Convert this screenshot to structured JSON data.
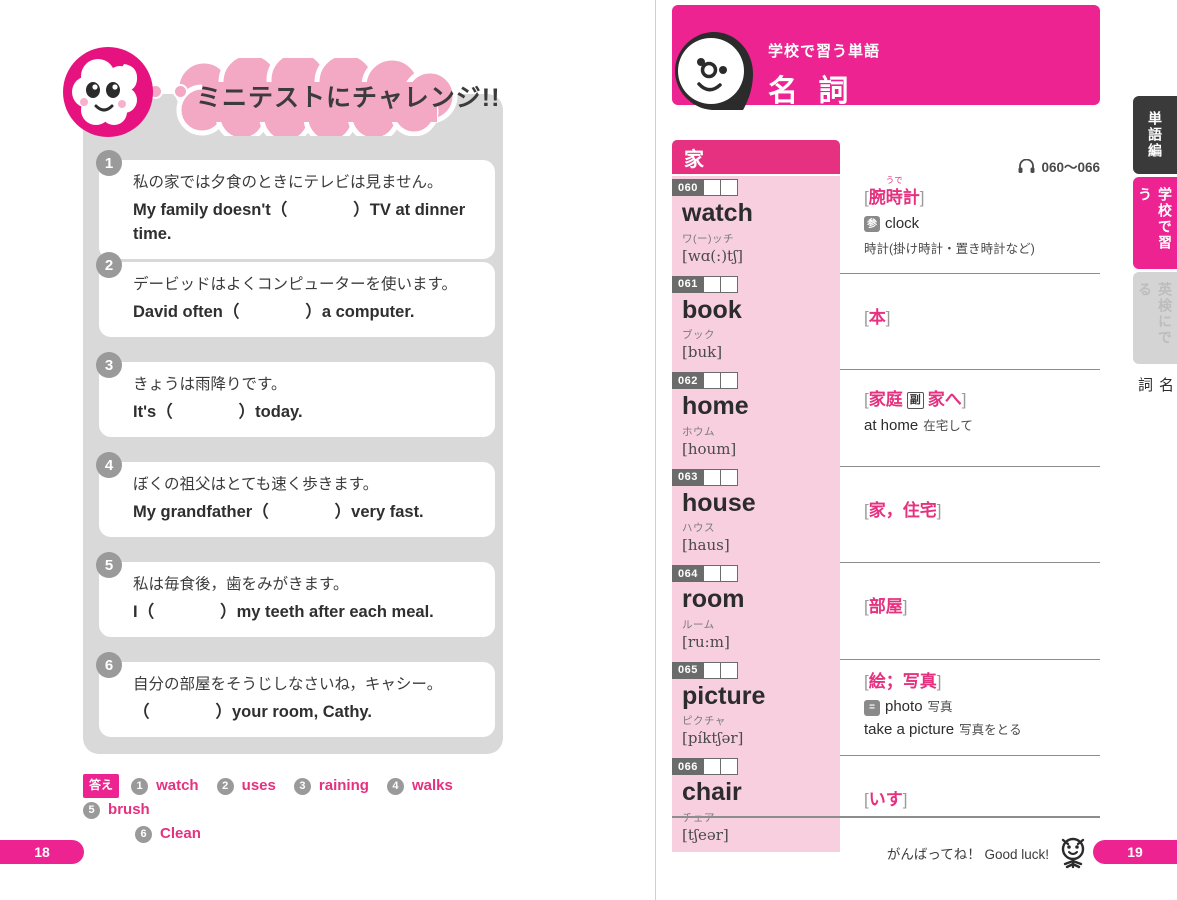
{
  "colors": {
    "brand_pink": "#ec2391",
    "accent_pink": "#e5317f",
    "light_pink": "#f7cfdf",
    "bubble_pink": "#f3a8c4",
    "panel_gray": "#d9d9d9",
    "tab_dark": "#3a3a3a"
  },
  "left_page": {
    "bubble_title": "ミニテストにチャレンジ!!",
    "page_number": "18",
    "questions": [
      {
        "num": "1",
        "jp": "私の家では夕食のときにテレビは見ません。",
        "en": "My family doesn't（　　　　）TV at dinner time."
      },
      {
        "num": "2",
        "jp": "デービッドはよくコンピューターを使います。",
        "en": "David often（　　　　）a computer."
      },
      {
        "num": "3",
        "jp": "きょうは雨降りです。",
        "en": "It's（　　　　）today."
      },
      {
        "num": "4",
        "jp": "ぼくの祖父はとても速く歩きます。",
        "en": "My grandfather（　　　　）very fast."
      },
      {
        "num": "5",
        "jp": "私は毎食後，歯をみがきます。",
        "en": "I（　　　　）my teeth after each meal."
      },
      {
        "num": "6",
        "jp": "自分の部屋をそうじしなさいね，キャシー。",
        "en": "（　　　　）your room, Cathy."
      }
    ],
    "answers": {
      "label": "答え",
      "items": [
        {
          "num": "1",
          "word": "watch"
        },
        {
          "num": "2",
          "word": "uses"
        },
        {
          "num": "3",
          "word": "raining"
        },
        {
          "num": "4",
          "word": "walks"
        },
        {
          "num": "5",
          "word": "brush"
        },
        {
          "num": "6",
          "word": "Clean"
        }
      ]
    }
  },
  "right_page": {
    "header": {
      "subtitle": "学校で習う単語",
      "title": "名 詞",
      "face_icon": "face-icon"
    },
    "category_tab": "家",
    "audio": {
      "icon": "headphone-icon",
      "range": "060〜066"
    },
    "entries": [
      {
        "num": "060",
        "word": "watch",
        "kana": "ワ(ー)ッチ",
        "ipa": "[wɑ(:)tʃ]",
        "meaning_open": "[",
        "meaning_ruby": "うで",
        "meaning_main": "腕時計",
        "meaning_close": "]",
        "note_icon": "参",
        "note_en": "clock",
        "note_jp": "時計(掛け時計・置き時計など)"
      },
      {
        "num": "061",
        "word": "book",
        "kana": "ブック",
        "ipa": "[buk]",
        "meaning_open": "[",
        "meaning_main": "本",
        "meaning_close": "]"
      },
      {
        "num": "062",
        "word": "home",
        "kana": "ホウム",
        "ipa": "[houm]",
        "meaning_open": "[",
        "meaning_main": "家庭",
        "pos_badge": "副",
        "meaning_extra": "家へ",
        "meaning_close": "]",
        "note_en": "at home",
        "note_jp": "在宅して"
      },
      {
        "num": "063",
        "word": "house",
        "kana": "ハウス",
        "ipa": "[haus]",
        "meaning_open": "[",
        "meaning_main": "家，住宅",
        "meaning_close": "]"
      },
      {
        "num": "064",
        "word": "room",
        "kana": "ルーム",
        "ipa": "[ru:m]",
        "meaning_open": "[",
        "meaning_main": "部屋",
        "meaning_close": "]"
      },
      {
        "num": "065",
        "word": "picture",
        "kana": "ピクチャ",
        "ipa": "[píktʃər]",
        "meaning_open": "[",
        "meaning_main": "絵；写真",
        "meaning_close": "]",
        "note_icon": "=",
        "note_en": "photo",
        "note_jp": "写真",
        "note2_en": "take a picture",
        "note2_jp": "写真をとる"
      },
      {
        "num": "066",
        "word": "chair",
        "kana": "チェア",
        "ipa": "[tʃeər]",
        "meaning_open": "[",
        "meaning_main": "いす",
        "meaning_close": "]"
      }
    ],
    "tabs": [
      {
        "label": "単語編",
        "state": "dark"
      },
      {
        "label": "学校で習う",
        "state": "active"
      },
      {
        "label": "英検にでる",
        "state": "inactive"
      },
      {
        "label": "名 詞",
        "state": "plain"
      }
    ],
    "footer_note": "がんばってね！ Good luck!",
    "page_number": "19"
  }
}
